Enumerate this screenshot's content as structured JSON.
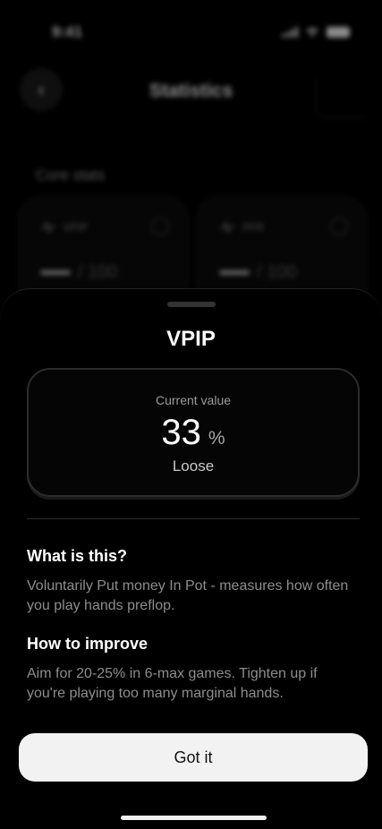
{
  "status_bar": {
    "time": "9:41",
    "icons": [
      "cellular-icon",
      "wifi-icon",
      "battery-icon"
    ]
  },
  "nav": {
    "back_icon": "chevron-left-icon",
    "title": "Statistics"
  },
  "background": {
    "section_label": "Core stats",
    "cards": [
      {
        "label": "VPIP",
        "value_suffix": "/ 100"
      },
      {
        "label": "PFR",
        "value_suffix": "/ 100"
      }
    ]
  },
  "sheet": {
    "title": "VPIP",
    "current": {
      "caption": "Current value",
      "value": "33",
      "unit": "%",
      "label": "Loose"
    },
    "sections": [
      {
        "heading": "What is this?",
        "body": "Voluntarily Put money In Pot - measures how often you play hands preflop."
      },
      {
        "heading": "How to improve",
        "body": "Aim for 20-25% in 6-max games. Tighten up if you're playing too many marginal hands."
      }
    ],
    "button_label": "Got it"
  },
  "colors": {
    "background": "#000000",
    "button_bg": "#f2f2f2",
    "muted_text": "#8d8d8d"
  }
}
